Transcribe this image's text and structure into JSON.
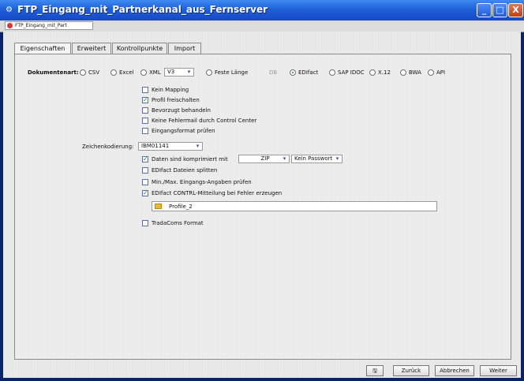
{
  "window": {
    "title": "FTP_Eingang_mit_Partnerkanal_aus_Fernserver",
    "minimize": "_",
    "maximize": "□",
    "close": "X",
    "subtab": "FTP_Eingang_mit_Part"
  },
  "tabs": [
    "Eigenschaften",
    "Erweitert",
    "Kontrollpunkte",
    "Import"
  ],
  "doctype": {
    "label": "Dokumentenart:",
    "options": {
      "csv": "CSV",
      "excel": "Excel",
      "xml": "XML",
      "xml_version": "V3",
      "feste_laenge": "Feste Länge",
      "db": "DB",
      "edifact": "EDIfact",
      "sap_idoc": "SAP IDOC",
      "x12": "X.12",
      "bwa": "BWA",
      "api": "API"
    },
    "selected": "EDIfact"
  },
  "checks1": [
    {
      "label": "Kein Mapping",
      "checked": false
    },
    {
      "label": "Profil freischalten",
      "checked": true
    },
    {
      "label": "Bevorzugt behandeln",
      "checked": false
    },
    {
      "label": "Keine Fehlermail durch Control Center",
      "checked": false
    },
    {
      "label": "Eingangsformat prüfen",
      "checked": false
    }
  ],
  "encoding": {
    "label": "Zeichenkodierung:",
    "value": "IBM01141"
  },
  "compressed": {
    "label": "Daten sind komprimiert mit",
    "checked": true,
    "format": "ZIP",
    "password": "Kein Passwort"
  },
  "checks2": [
    {
      "label": "EDIfact Dateien splitten",
      "checked": false
    },
    {
      "label": "Min./Max. Eingangs-Angaben prüfen",
      "checked": false
    },
    {
      "label": "EDIfact CONTRL-Mitteilung bei Fehler erzeugen",
      "checked": true
    }
  ],
  "profile_field": "Profile_2",
  "tradacoms": {
    "label": "TradaComs Format",
    "checked": false
  },
  "buttons": {
    "back": "Zurück",
    "cancel": "Abbrechen",
    "next": "Weiter"
  }
}
